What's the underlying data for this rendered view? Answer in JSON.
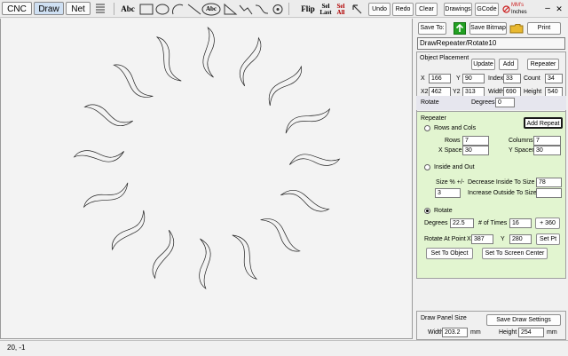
{
  "tabs": [
    {
      "label": "CNC"
    },
    {
      "label": "Draw"
    },
    {
      "label": "Net"
    }
  ],
  "toolbar": {
    "text_tool": "Abc",
    "text_circle_tool": "Abc",
    "flip": "Flip",
    "sel_last_1": "Sel",
    "sel_last_2": "Last",
    "sel_all_1": "Sel",
    "sel_all_2": "All",
    "undo": "Undo",
    "redo": "Redo",
    "clear": "Clear",
    "drawings": "Drawings",
    "gcode": "GCode",
    "mm_label": "MM's",
    "inches_label": "Inches",
    "minimize": "–",
    "close": "✕"
  },
  "panel": {
    "save_to": "Save To:",
    "save_bitmap": "Save Bitmap",
    "print": "Print",
    "drawing_name": "DrawRepeater/Rotate10",
    "object_placement": {
      "title": "Object Placement",
      "update": "Update",
      "add": "Add",
      "repeater": "Repeater",
      "x_label": "X",
      "x": "166",
      "y_label": "Y",
      "y": "90",
      "index_label": "Index",
      "index": "33",
      "count_label": "Count",
      "count": "34",
      "x2_label": "X2",
      "x2": "462",
      "y2_label": "Y2",
      "y2": "313",
      "width_label": "Width",
      "width": "690",
      "height_label": "Height",
      "height": "540"
    },
    "rotate_bar": {
      "label": "Rotate",
      "degrees_label": "Degrees",
      "degrees": "0"
    },
    "repeater": {
      "title": "Repeater",
      "add_repeat": "Add Repeat",
      "rows_cols": "Rows and Cols",
      "rows_label": "Rows",
      "rows": "7",
      "columns_label": "Columns",
      "columns": "7",
      "x_spacer_label": "X Spacer",
      "x_spacer": "30",
      "y_spacer_label": "Y Spacer",
      "y_spacer": "30",
      "inside_out": "Inside and Out",
      "size_label": "Size % +/-",
      "decrease_label": "Decrease Inside To Size %",
      "decrease": "78",
      "size": "3",
      "increase_label": "Increase Outside To Size %",
      "increase": "",
      "rotate": "Rotate",
      "degrees_label": "Degrees",
      "degrees": "22.5",
      "times_label": "# of Times",
      "times": "16",
      "plus360": "+ 360",
      "rotate_point_label": "Rotate At Point",
      "rp_x_label": "X",
      "rp_x": "387",
      "rp_y_label": "Y",
      "rp_y": "280",
      "set_pt": "Set Pt",
      "set_to_object": "Set To Object",
      "set_to_center": "Set To Screen Center"
    },
    "draw_panel": {
      "title": "Draw Panel Size",
      "save_settings": "Save Draw Settings",
      "width_label": "Width",
      "width": "203.2",
      "width_unit": "mm",
      "height_label": "Height",
      "height": "254",
      "height_unit": "mm"
    }
  },
  "status": {
    "coords": "20, -1"
  },
  "colors": {
    "repeater_bg": "#e2f5d0",
    "rotate_bar_bg": "#e6e6ee",
    "active_tab": "#cfe0f3",
    "save_icon": "#22a022",
    "folder_icon": "#e8b830",
    "units_icon": "#cc2020"
  },
  "shapes": {
    "count": 16,
    "step_degrees": 22.5
  }
}
